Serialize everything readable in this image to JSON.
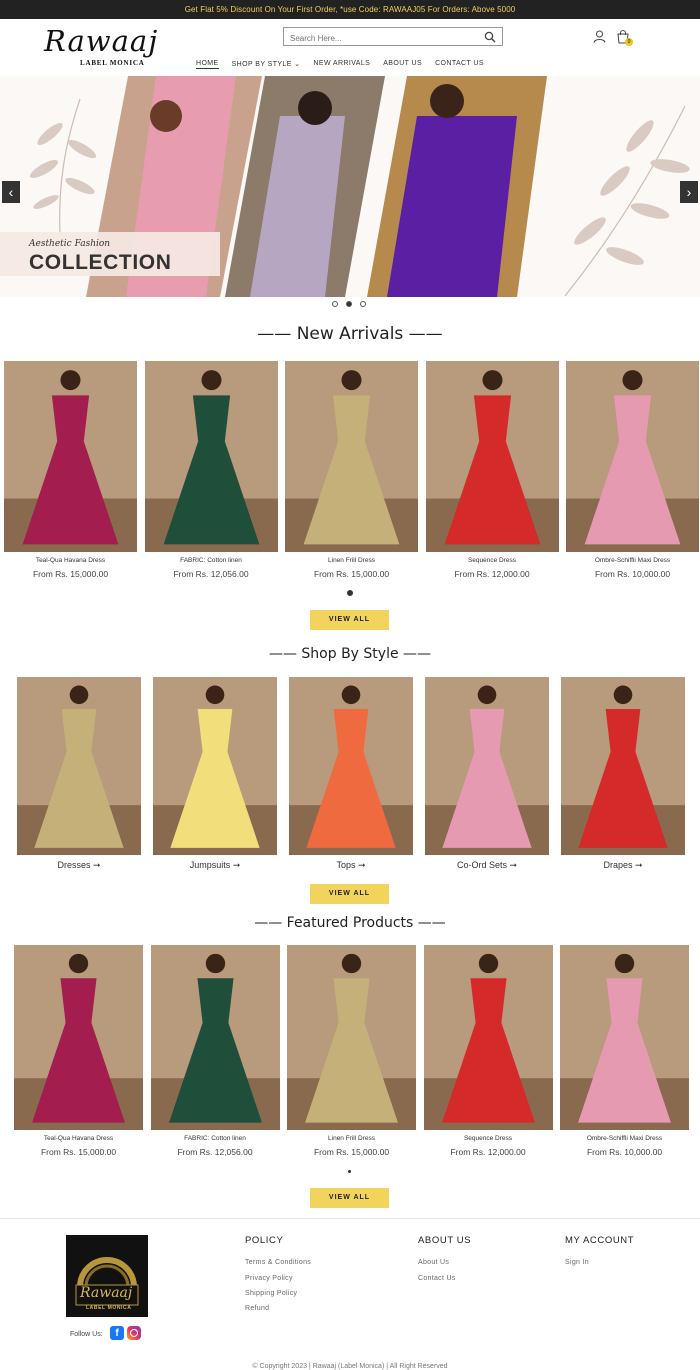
{
  "announcement": "Get Flat 5% Discount On Your First Order, *use Code: RAWAAJ05 For Orders: Above 5000",
  "logo": {
    "script": "Rawaaj",
    "tagline": "LABEL MONICA"
  },
  "search": {
    "placeholder": "Search Here..."
  },
  "cart": {
    "count": "0"
  },
  "nav": [
    "HOME",
    "SHOP BY STYLE ⌄",
    "NEW ARRIVALS",
    "ABOUT US",
    "CONTACT US"
  ],
  "hero": {
    "subtitle": "Aesthetic Fashion",
    "title": "COLLECTION",
    "prev": "‹",
    "next": "›"
  },
  "new_arrivals": {
    "title": "—— New Arrivals ——",
    "products": [
      {
        "name": "Teal-Qua Havana Dress",
        "price": "From Rs. 15,000.00",
        "color": "#a31d4f"
      },
      {
        "name": "FABRIC: Cotton linen",
        "price": "From Rs. 12,056.00",
        "color": "#1f4e3a"
      },
      {
        "name": "Linen Frill Dress",
        "price": "From Rs. 15,000.00",
        "color": "#c6b07a"
      },
      {
        "name": "Sequence Dress",
        "price": "From Rs. 12,000.00",
        "color": "#d42a2a"
      },
      {
        "name": "Ombre-Schiffli Maxi Dress",
        "price": "From Rs. 10,000.00",
        "color": "#e69ab2"
      }
    ],
    "view_all": "VIEW ALL"
  },
  "shop_by_style": {
    "title": "—— Shop By Style ——",
    "items": [
      {
        "label": "Dresses ➞",
        "color": "#c6b07a"
      },
      {
        "label": "Jumpsuits ➞",
        "color": "#f2de7a"
      },
      {
        "label": "Tops ➞",
        "color": "#ef6b3f"
      },
      {
        "label": "Co-Ord Sets ➞",
        "color": "#e69ab2"
      },
      {
        "label": "Drapes ➞",
        "color": "#d42a2a"
      }
    ],
    "view_all": "VIEW ALL"
  },
  "featured": {
    "title": "—— Featured Products ——",
    "products": [
      {
        "name": "Teal-Qua Havana Dress",
        "price": "From Rs. 15,000.00",
        "color": "#a31d4f"
      },
      {
        "name": "FABRIC: Cotton linen",
        "price": "From Rs. 12,056.00",
        "color": "#1f4e3a"
      },
      {
        "name": "Linen Frill Dress",
        "price": "From Rs. 15,000.00",
        "color": "#c6b07a"
      },
      {
        "name": "Sequence Dress",
        "price": "From Rs. 12,000.00",
        "color": "#d42a2a"
      },
      {
        "name": "Ombre-Schiffli Maxi Dress",
        "price": "From Rs. 10,000.00",
        "color": "#e69ab2"
      }
    ],
    "view_all": "VIEW ALL"
  },
  "footer": {
    "logo_script": "Rawaaj",
    "logo_tag": "LABEL MONICA",
    "follow": "Follow Us:",
    "policy": {
      "title": "POLICY",
      "links": [
        "Terms & Conditions",
        "Privacy Policy",
        "Shipping Policy",
        "Refund"
      ]
    },
    "about": {
      "title": "ABOUT US",
      "links": [
        "About Us",
        "Contact Us"
      ]
    },
    "account": {
      "title": "MY ACCOUNT",
      "links": [
        "Sign In"
      ]
    },
    "copyright": "© Copyright 2023 | Rawaaj (Label Monica) | All Right Reserved"
  }
}
